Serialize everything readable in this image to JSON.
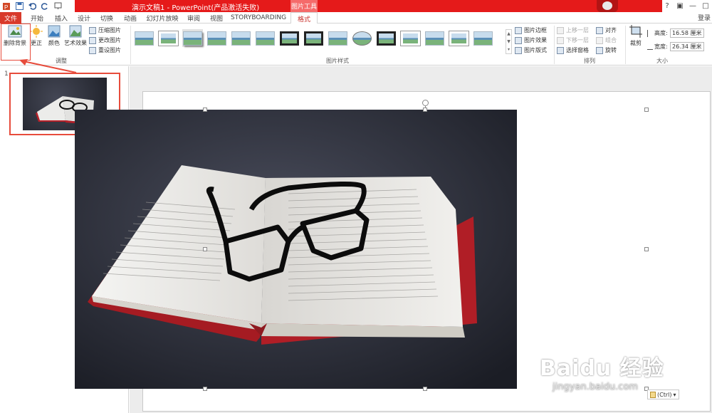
{
  "title_bar": {
    "document_title": "演示文稿1 - PowerPoint(产品激活失败)",
    "picture_tools_label": "图片工具"
  },
  "tabs": [
    "文件",
    "开始",
    "插入",
    "设计",
    "切换",
    "动画",
    "幻灯片放映",
    "审阅",
    "视图",
    "STORYBOARDING",
    "格式"
  ],
  "login_label": "登录",
  "adjust_group": {
    "remove_bg": "删除背景",
    "correct": "更正",
    "color": "颜色",
    "art_effects": "艺术效果",
    "compress": "压缩图片",
    "change": "更改图片",
    "reset": "重设图片",
    "label": "调整"
  },
  "styles_group": {
    "border": "图片边框",
    "effects": "图片效果",
    "layout": "图片版式",
    "label": "图片样式"
  },
  "arrange_group": {
    "bring_forward": "上移一层",
    "send_backward": "下移一层",
    "selection_pane": "选择窗格",
    "align": "对齐",
    "group": "组合",
    "rotate": "旋转",
    "label": "排列"
  },
  "size_group": {
    "crop": "裁剪",
    "height_label": "高度:",
    "height_value": "16.58 厘米",
    "width_label": "宽度:",
    "width_value": "26.34 厘米",
    "label": "大小"
  },
  "slide_panel": {
    "slide_number": "1"
  },
  "paste_options": "(Ctrl)",
  "watermark": {
    "line1": "Baidu 经验",
    "line2": "jingyan.baidu.com"
  },
  "colors": {
    "accent": "#e51a1a",
    "file_tab": "#d83a2b",
    "highlight": "#e74c3c"
  }
}
